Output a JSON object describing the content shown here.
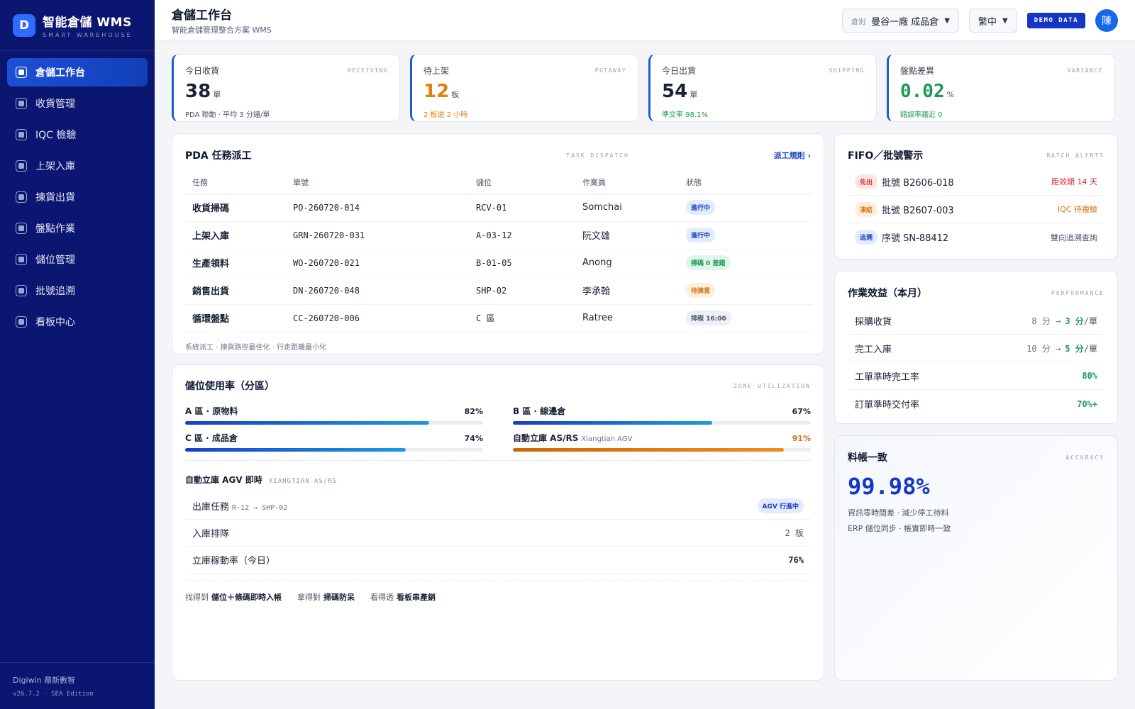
{
  "brand": {
    "logo_letter": "D",
    "title": "智能倉儲 WMS",
    "subtitle": "SMART WAREHOUSE"
  },
  "sidebar": {
    "items": [
      {
        "label": "倉儲工作台",
        "active": true
      },
      {
        "label": "收貨管理"
      },
      {
        "label": "IQC 檢驗"
      },
      {
        "label": "上架入庫"
      },
      {
        "label": "揀貨出貨"
      },
      {
        "label": "盤點作業"
      },
      {
        "label": "儲位管理"
      },
      {
        "label": "批號追溯"
      },
      {
        "label": "看板中心"
      }
    ],
    "footer": {
      "company": "Digiwin 鼎新數智",
      "version": "v26.7.2 · SEA Edition"
    }
  },
  "header": {
    "title": "倉儲工作台",
    "subtitle": "智能倉儲管理整合方案 WMS",
    "warehouse_label": "倉別",
    "warehouse_value": "曼谷一廠 成品倉",
    "language": "繁中",
    "demo_badge": "DEMO DATA",
    "avatar_initial": "陳"
  },
  "kpis": [
    {
      "label": "今日收貨",
      "en": "RECEIVING",
      "value": "38",
      "unit": "單",
      "note": "PDA 聯動 · 平均 3 分鐘/單",
      "color": "#1a2233",
      "note_color": "#4b5466"
    },
    {
      "label": "待上架",
      "en": "PUTAWAY",
      "value": "12",
      "unit": "板",
      "note": "2 板逾 2 小時",
      "color": "#e0820f",
      "note_color": "#e0820f"
    },
    {
      "label": "今日出貨",
      "en": "SHIPPING",
      "value": "54",
      "unit": "單",
      "note": "準交率 98.1%",
      "color": "#1a2233",
      "note_color": "#1c9a55"
    },
    {
      "label": "盤點差異",
      "en": "VARIANCE",
      "value": "0.02",
      "unit": "%",
      "note": "錯誤率趨近 0",
      "color": "#1c9a55",
      "note_color": "#1c9a55"
    }
  ],
  "dispatch": {
    "title": "PDA 任務派工",
    "en": "TASK DISPATCH",
    "link": "派工規則 ›",
    "columns": [
      "任務",
      "單號",
      "儲位",
      "作業員",
      "狀態"
    ],
    "rows": [
      {
        "task": "收貨掃碼",
        "no": "PO-260720-014",
        "loc": "RCV-01",
        "op": "Somchai",
        "status": "進行中",
        "badge": "b-blue"
      },
      {
        "task": "上架入庫",
        "no": "GRN-260720-031",
        "loc": "A-03-12",
        "op": "阮文雄",
        "status": "進行中",
        "badge": "b-blue"
      },
      {
        "task": "生產領料",
        "no": "WO-260720-021",
        "loc": "B-01-05",
        "op": "Anong",
        "status": "掃碼 0 差錯",
        "badge": "b-green"
      },
      {
        "task": "銷售出貨",
        "no": "DN-260720-048",
        "loc": "SHP-02",
        "op": "李承翰",
        "status": "待揀貨",
        "badge": "b-orange"
      },
      {
        "task": "循環盤點",
        "no": "CC-260720-006",
        "loc": "C 區",
        "op": "Ratree",
        "status": "排程 16:00",
        "badge": "b-gray"
      }
    ],
    "footnote": "系統派工 · 揀貨路徑最佳化 · 行走距離最小化"
  },
  "utilization": {
    "title": "儲位使用率（分區）",
    "en": "ZONE UTILIZATION",
    "zones": [
      {
        "label": "A 區 · 原物料",
        "sub": "",
        "value": 82,
        "display": "82%",
        "warn": false
      },
      {
        "label": "B 區 · 線邊倉",
        "sub": "",
        "value": 67,
        "display": "67%",
        "warn": false
      },
      {
        "label": "C 區 · 成品倉",
        "sub": "",
        "value": 74,
        "display": "74%",
        "warn": false
      },
      {
        "label": "自動立庫 AS/RS",
        "sub": "Xiangtian AGV",
        "value": 91,
        "display": "91%",
        "warn": true
      }
    ],
    "agv_title": "自動立庫 AGV 即時",
    "agv_en": "XIANGTIAN AS/RS",
    "agv_rows": [
      {
        "label": "出庫任務",
        "sub": "R-12 → SHP-02",
        "value": "AGV 行進中"
      },
      {
        "label": "入庫排隊",
        "sub": "",
        "value": "2 板"
      },
      {
        "label": "立庫稼動率（今日）",
        "sub": "",
        "value": "76%"
      }
    ],
    "slogans": [
      {
        "pre": "找得到",
        "bold": "儲位＋條碼即時入帳"
      },
      {
        "pre": "拿得對",
        "bold": "掃碼防呆"
      },
      {
        "pre": "看得透",
        "bold": "看板串產銷"
      }
    ]
  },
  "fifo": {
    "title": "FIFO／批號警示",
    "en": "BATCH ALERTS",
    "items": [
      {
        "tag": "先出",
        "tag_bg": "#fde4e4",
        "tag_color": "#d42b2b",
        "text": "批號 B2606-018",
        "right": "距效期 14 天",
        "right_color": "#d42b2b"
      },
      {
        "tag": "凍結",
        "tag_bg": "#fdefdc",
        "tag_color": "#d27615",
        "text": "批號 B2607-003",
        "right": "IQC 待複驗",
        "right_color": "#d27615"
      },
      {
        "tag": "追溯",
        "tag_bg": "#e3ebff",
        "tag_color": "#1940c2",
        "text": "序號 SN-88412",
        "right": "雙向追溯查詢",
        "right_color": "#4b5466"
      }
    ]
  },
  "performance": {
    "title": "作業效益（本月）",
    "en": "PERFORMANCE",
    "rows": [
      {
        "label": "採購收貨",
        "from": "8 分 →",
        "to": "3 分",
        "unit": "/單"
      },
      {
        "label": "完工入庫",
        "from": "10 分 →",
        "to": "5 分",
        "unit": "/單"
      },
      {
        "label": "工單準時完工率",
        "from": "",
        "to": "80%",
        "unit": ""
      },
      {
        "label": "訂單準時交付率",
        "from": "",
        "to": "70%+",
        "unit": ""
      }
    ]
  },
  "accuracy": {
    "title": "料帳一致",
    "en": "ACCURACY",
    "value": "99.98%",
    "line1": "資訊零時間差 · 減少停工待料",
    "line2": "ERP 儲位同步 · 帳實即時一致"
  }
}
